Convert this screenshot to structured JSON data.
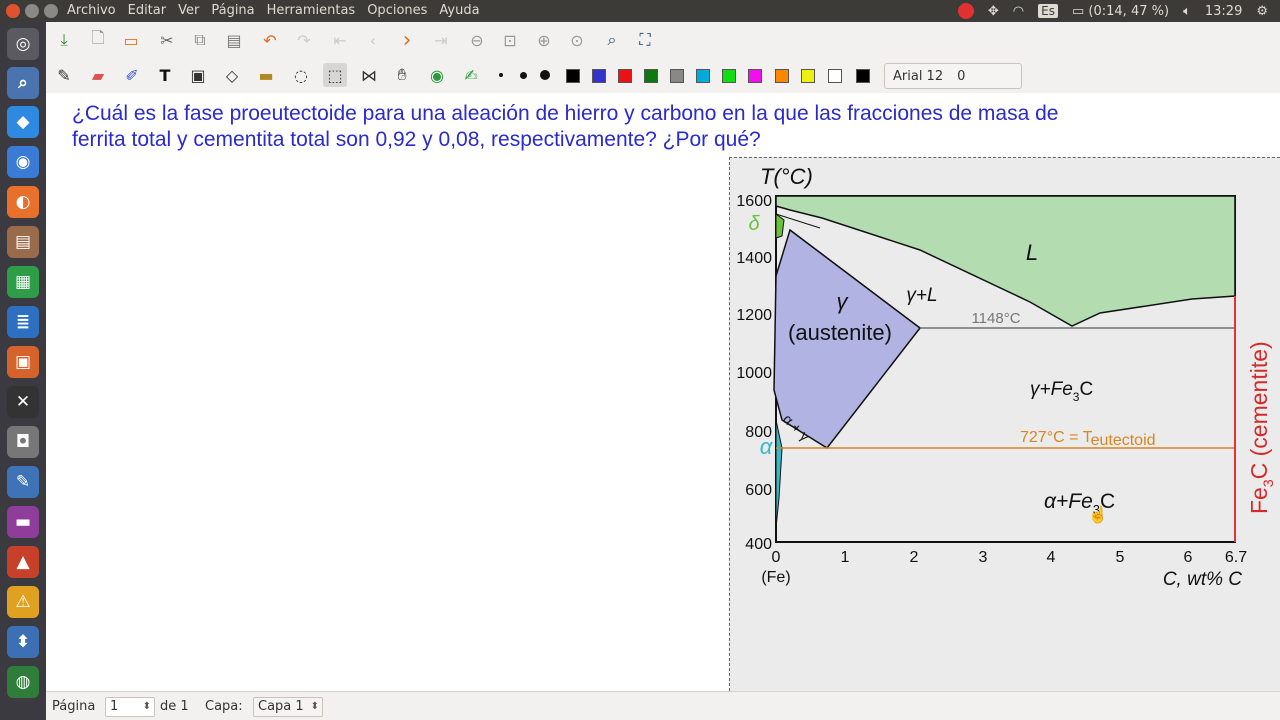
{
  "topbar": {
    "menus": [
      "Archivo",
      "Editar",
      "Ver",
      "Página",
      "Herramientas",
      "Opciones",
      "Ayuda"
    ],
    "lang": "Es",
    "battery": "(0:14, 47 %)",
    "clock": "13:29"
  },
  "toolbar": {
    "font_name": "Arial 12",
    "font_value": "0",
    "colors": [
      "#000000",
      "#3333cc",
      "#ee1111",
      "#117711",
      "#888888",
      "#00aadd",
      "#11dd11",
      "#ee11ee",
      "#ff8800",
      "#eeee11",
      "#ffffff",
      "#000000"
    ]
  },
  "question": {
    "line1": "¿Cuál es la fase proeutectoide para una aleación de hierro y carbono en la que las fracciones de masa de",
    "line2": "ferrita total y cementita total son 0,92 y 0,08, respectivamente? ¿Por qué?"
  },
  "diagram": {
    "y_axis_label": "T(°C)",
    "y_ticks": [
      "1600",
      "1400",
      "1200",
      "1000",
      "800",
      "600",
      "400"
    ],
    "x_ticks": [
      "0",
      "1",
      "2",
      "3",
      "4",
      "5",
      "6",
      "6.7"
    ],
    "x_sub_label": "(Fe)",
    "x_axis_label": "C, wt% C",
    "label_L": "L",
    "label_gamma": "γ",
    "label_austenite": "(austenite)",
    "label_gamma_L": "γ+L",
    "label_1148": "1148°C",
    "label_delta": "δ",
    "label_alpha": "α",
    "label_alpha_gamma": "α + γ",
    "label_eutectoid_base": "727°C = T",
    "label_eutectoid_sub": "eutectoid",
    "label_gamma_fe3c_a": "γ+Fe",
    "label_gamma_fe3c_b": "3",
    "label_gamma_fe3c_c": "C",
    "label_alpha_fe3c_a": "α+Fe",
    "label_alpha_fe3c_b": "3",
    "label_alpha_fe3c_c": "C",
    "label_cementite_a": "Fe",
    "label_cementite_b": "3",
    "label_cementite_c": "C (cementite)",
    "colors": {
      "liquid": "#b3ddb1",
      "austenite": "#b1b3e3",
      "eutectoid_line": "#d8861f",
      "cementite_line": "#e33333",
      "alpha": "#3ab8c8",
      "delta": "#6ac33a"
    }
  },
  "status": {
    "page_label": "Página",
    "page_value": "1",
    "page_total": "de 1",
    "layer_label": "Capa:",
    "layer_value": "Capa 1"
  }
}
